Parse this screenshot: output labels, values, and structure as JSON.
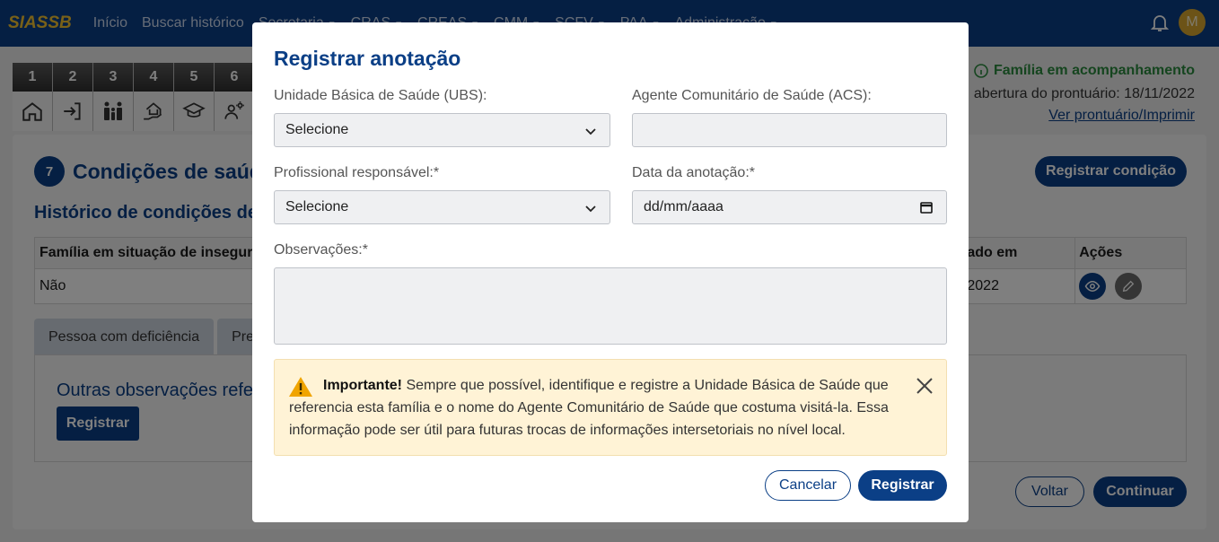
{
  "app": {
    "brand": "SIASSB",
    "nav": [
      {
        "label": "Início",
        "dropdown": false
      },
      {
        "label": "Buscar histórico",
        "dropdown": false
      },
      {
        "label": "Secretaria",
        "dropdown": true
      },
      {
        "label": "CRAS",
        "dropdown": true
      },
      {
        "label": "CREAS",
        "dropdown": true
      },
      {
        "label": "CMM",
        "dropdown": true
      },
      {
        "label": "SCFV",
        "dropdown": true
      },
      {
        "label": "PAA",
        "dropdown": true
      },
      {
        "label": "Administração",
        "dropdown": true
      }
    ],
    "avatar_initial": "M",
    "colors": {
      "primary": "#0b3f86",
      "brand": "#f2c230",
      "success": "#2b8a3e",
      "alert_bg": "#fff3d6",
      "warning": "#f0a400"
    }
  },
  "steps": [
    {
      "num": "1",
      "icon": "home-icon"
    },
    {
      "num": "2",
      "icon": "login-icon"
    },
    {
      "num": "3",
      "icon": "family-icon"
    },
    {
      "num": "4",
      "icon": "house-hand-icon"
    },
    {
      "num": "5",
      "icon": "graduation-cap-icon"
    },
    {
      "num": "6",
      "icon": "worker-icon"
    }
  ],
  "status": {
    "state": "Família em acompanhamento",
    "opening": "abertura do prontuário: 18/11/2022",
    "link": "Ver prontuário/Imprimir"
  },
  "section": {
    "number": "7",
    "title": "Condições de saúde",
    "register_button": "Registrar condição",
    "history_title": "Histórico de condições de",
    "table": {
      "headers": [
        "Família em situação de insegura",
        "ado em",
        "Ações"
      ],
      "rows": [
        {
          "col1": "Não",
          "col2": "2022"
        }
      ]
    },
    "tabs": [
      "Pessoa com deficiência",
      "Pres"
    ],
    "panel_title": "Outras observações refe",
    "panel_button": "Registrar",
    "back": "Voltar",
    "continue": "Continuar"
  },
  "modal": {
    "title": "Registrar anotação",
    "ubs_label": "Unidade Básica de Saúde (UBS):",
    "ubs_value": "Selecione",
    "acs_label": "Agente Comunitário de Saúde (ACS):",
    "acs_value": "",
    "prof_label": "Profissional responsável:*",
    "prof_value": "Selecione",
    "date_label": "Data da anotação:*",
    "date_placeholder": "dd/mm/aaaa",
    "obs_label": "Observações:*",
    "alert_bold": "Importante!",
    "alert_text": "Sempre que possível, identifique e registre a Unidade Básica de Saúde que referencia esta família e o nome do Agente Comunitário de Saúde que costuma visitá-la. Essa informação pode ser útil para futuras trocas de informações intersetoriais no nível local.",
    "cancel": "Cancelar",
    "submit": "Registrar"
  }
}
